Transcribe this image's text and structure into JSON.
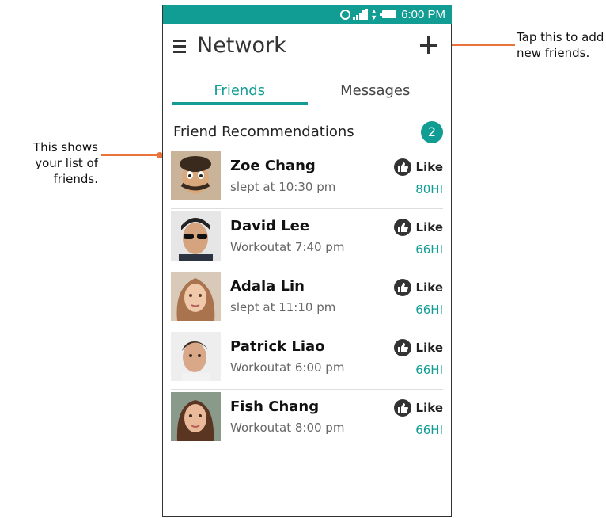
{
  "callouts": {
    "left": "This shows your list of friends.",
    "right": "Tap this to add new friends."
  },
  "status_bar": {
    "time": "6:00 PM",
    "icons": [
      "alarm-icon",
      "signal-icon",
      "data-arrows-icon",
      "battery-icon"
    ]
  },
  "app_bar": {
    "title": "Network",
    "menu_icon": "menu-icon",
    "add_icon": "add-icon"
  },
  "tabs": [
    {
      "label": "Friends",
      "active": true
    },
    {
      "label": "Messages",
      "active": false
    }
  ],
  "section": {
    "title": "Friend Recommendations",
    "count": "2"
  },
  "friends": [
    {
      "name": "Zoe Chang",
      "activity": "slept at 10:30 pm",
      "like_label": "Like",
      "hi": "80HI"
    },
    {
      "name": "David Lee",
      "activity": "Workoutat 7:40 pm",
      "like_label": "Like",
      "hi": "66HI"
    },
    {
      "name": "Adala Lin",
      "activity": "slept at 11:10 pm",
      "like_label": "Like",
      "hi": "66HI"
    },
    {
      "name": "Patrick Liao",
      "activity": "Workoutat 6:00 pm",
      "like_label": "Like",
      "hi": "66HI"
    },
    {
      "name": "Fish Chang",
      "activity": "Workoutat 8:00 pm",
      "like_label": "Like",
      "hi": "66HI"
    }
  ],
  "colors": {
    "accent": "#129d94",
    "callout_line": "#e8743b"
  }
}
